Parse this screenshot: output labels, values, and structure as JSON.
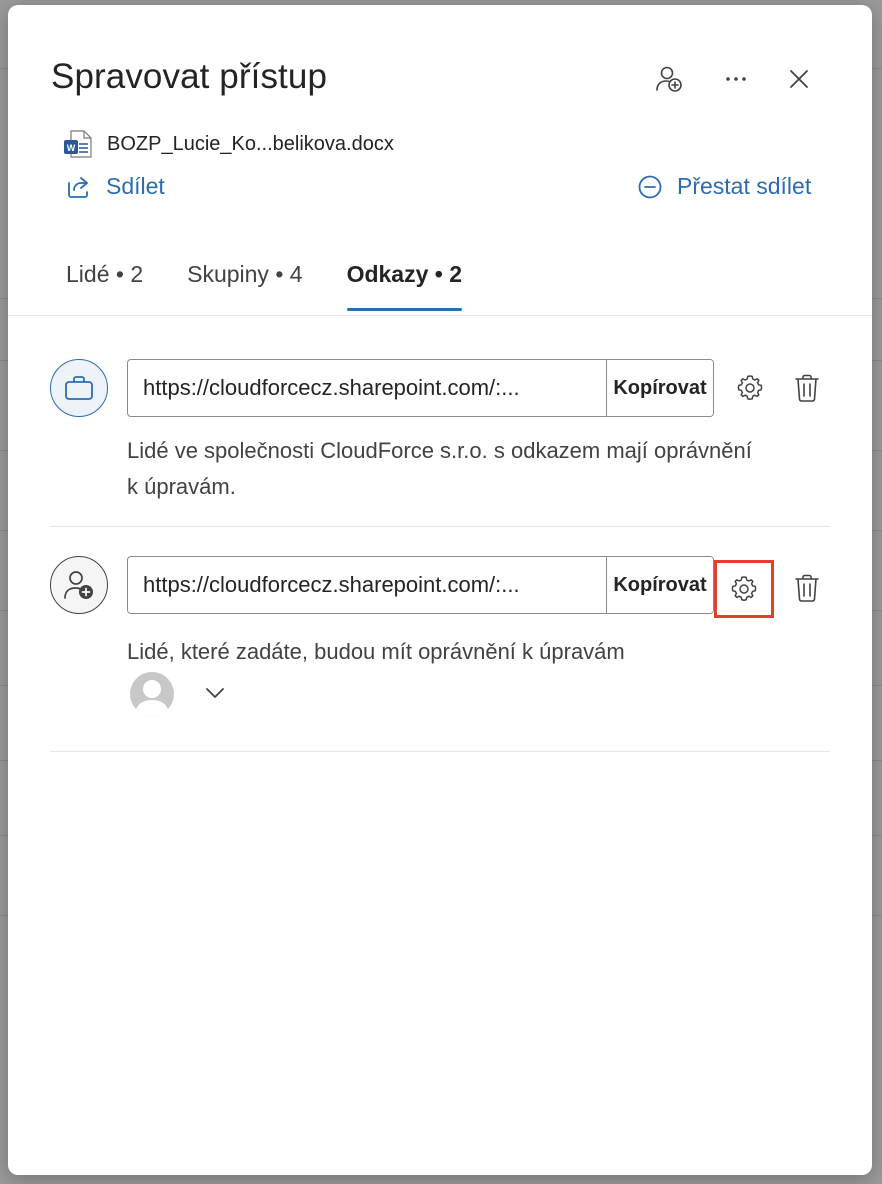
{
  "dialog": {
    "title": "Spravovat přístup",
    "file_name": "BOZP_Lucie_Ko...belikova.docx",
    "share_label": "Sdílet",
    "stop_share_label": "Přestat sdílet"
  },
  "tabs": [
    {
      "label": "Lidé • 2",
      "active": false
    },
    {
      "label": "Skupiny • 4",
      "active": false
    },
    {
      "label": "Odkazy • 2",
      "active": true
    }
  ],
  "links": [
    {
      "url": "https://cloudforcecz.sharepoint.com/:...",
      "copy_label": "Kopírovat",
      "description": "Lidé ve společnosti CloudForce s.r.o. s odkazem mají oprávnění k úpravám.",
      "icon": "briefcase-icon"
    },
    {
      "url": "https://cloudforcecz.sharepoint.com/:...",
      "copy_label": "Kopírovat",
      "description": "Lidé, které zadáte, budou mít oprávnění k úpravám",
      "icon": "person-add-icon"
    }
  ],
  "colors": {
    "accent": "#2b6cb3",
    "highlight": "#e0412c",
    "word_blue": "#2b579a"
  }
}
